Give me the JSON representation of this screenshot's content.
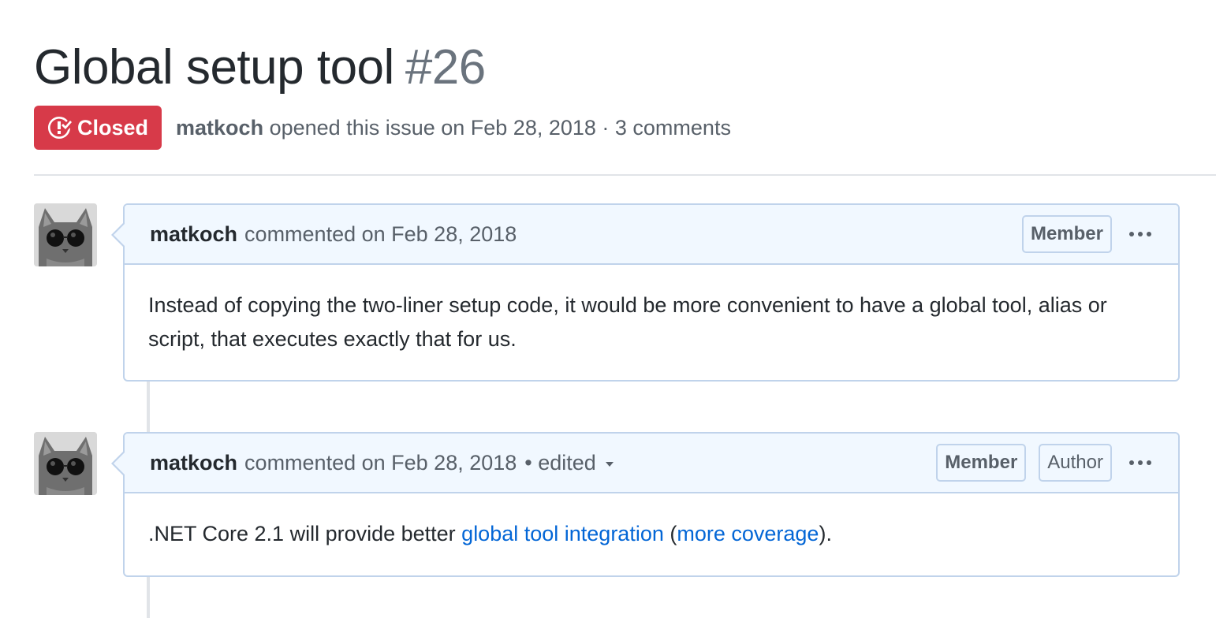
{
  "issue": {
    "title": "Global setup tool",
    "number": "#26",
    "state": "Closed",
    "author": "matkoch",
    "opened_text": "opened this issue on Feb 28, 2018 · 3 comments"
  },
  "comments": [
    {
      "author": "matkoch",
      "timestamp": "commented on Feb 28, 2018",
      "labels": [
        "Member"
      ],
      "body": "Instead of copying the two-liner setup code, it would be more convenient to have a global tool, alias or script, that executes exactly that for us."
    },
    {
      "author": "matkoch",
      "timestamp": "commented on Feb 28, 2018",
      "edited": "• edited",
      "labels": [
        "Member",
        "Author"
      ],
      "body_prefix": ".NET Core 2.1 will provide better ",
      "link1": "global tool integration",
      "between": " (",
      "link2": "more coverage",
      "body_suffix": ")."
    }
  ],
  "icons": {
    "state": "issue-closed-icon",
    "avatar": "cat-avatar",
    "menu": "kebab-icon"
  },
  "colors": {
    "closed": "#d73a49",
    "link": "#0366d6",
    "header_bg": "#f1f8ff",
    "border": "#c0d3eb"
  }
}
